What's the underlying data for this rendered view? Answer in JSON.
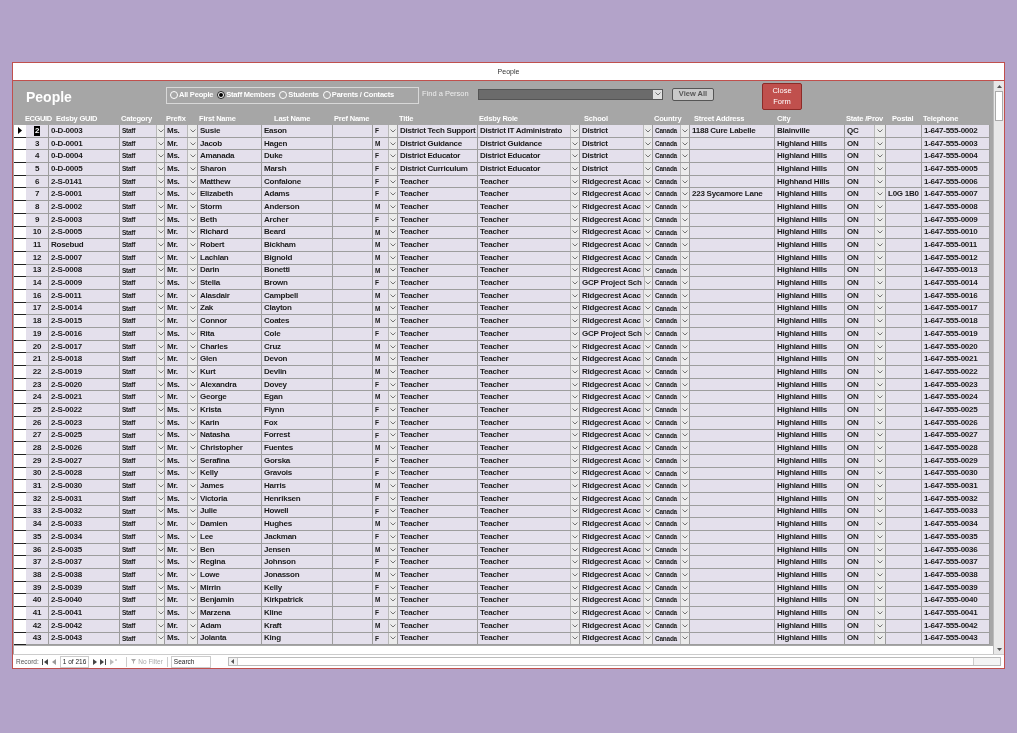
{
  "window": {
    "title": "People"
  },
  "form": {
    "title": "People",
    "filter_options": [
      {
        "label": "All People",
        "selected": false
      },
      {
        "label": "Staff Members",
        "selected": true
      },
      {
        "label": "Students",
        "selected": false
      },
      {
        "label": "Parents / Contacts",
        "selected": false
      }
    ],
    "find_label": "Find a Person",
    "view_all": "View All",
    "close": "Close Form"
  },
  "table": {
    "columns": [
      "ECGUID",
      "Edsby GUID",
      "Category",
      "Prefix",
      "First Name",
      "Last Name",
      "Pref Name",
      "Title",
      "Edsby Role",
      "School",
      "Country",
      "Street Address",
      "City",
      "State /Prov",
      "Postal",
      "Telephone"
    ],
    "rows": [
      {
        "selected": true,
        "ecguid": "2",
        "guid": "0-D-0003",
        "category": "Staff",
        "prefix": "Ms.",
        "first": "Susie",
        "last": "Eason",
        "gender": "F",
        "title": "District Tech Support",
        "role": "District IT Administrato",
        "school": "District",
        "country": "Canada",
        "street": "1188 Cure Labelle",
        "city": "Blainville",
        "prov": "QC",
        "phone": "1-647-555-0002"
      },
      {
        "selected": false,
        "ecguid": "3",
        "guid": "0-D-0001",
        "category": "Staff",
        "prefix": "Mr.",
        "first": "Jacob",
        "last": "Hagen",
        "gender": "M",
        "title": "District Guidance",
        "role": "District Guidance",
        "school": "District",
        "country": "Canada",
        "city": "Highland Hills",
        "prov": "ON",
        "phone": "1-647-555-0003"
      },
      {
        "selected": false,
        "ecguid": "4",
        "guid": "0-D-0004",
        "category": "Staff",
        "prefix": "Ms.",
        "first": "Amanada",
        "last": "Duke",
        "gender": "F",
        "title": "District Educator",
        "role": "District Educator",
        "school": "District",
        "country": "Canada",
        "city": "Highland Hills",
        "prov": "ON",
        "phone": "1-647-555-0004"
      },
      {
        "selected": false,
        "ecguid": "5",
        "guid": "0-D-0005",
        "category": "Staff",
        "prefix": "Ms.",
        "first": "Sharon",
        "last": "Marsh",
        "gender": "F",
        "title": "District Curriculum",
        "role": "District Educator",
        "school": "District",
        "country": "Canada",
        "city": "Highland Hills",
        "prov": "ON",
        "phone": "1-647-555-0005"
      },
      {
        "selected": false,
        "ecguid": "6",
        "guid": "2-S-0141",
        "category": "Staff",
        "prefix": "Ms.",
        "first": "Matthew",
        "last": "Confalone",
        "gender": "F",
        "title": "Teacher",
        "role": "Teacher",
        "school": "Ridgecrest Acac",
        "country": "Canada",
        "city": "Highhand Hills",
        "prov": "ON",
        "phone": "1-647-555-0006"
      },
      {
        "selected": false,
        "ecguid": "7",
        "guid": "2-S-0001",
        "category": "Staff",
        "prefix": "Ms.",
        "first": "Elizabeth",
        "last": "Adams",
        "gender": "F",
        "title": "Teacher",
        "role": "Teacher",
        "school": "Ridgecrest Acac",
        "country": "Canada",
        "street": "223 Sycamore Lane",
        "city": "Highland Hills",
        "prov": "ON",
        "postal": "L0G 1B0",
        "phone": "1-647-555-0007"
      },
      {
        "selected": false,
        "ecguid": "8",
        "guid": "2-S-0002",
        "category": "Staff",
        "prefix": "Mr.",
        "first": "Storm",
        "last": "Anderson",
        "gender": "M",
        "title": "Teacher",
        "role": "Teacher",
        "school": "Ridgecrest Acac",
        "country": "Canada",
        "city": "Highland Hills",
        "prov": "ON",
        "phone": "1-647-555-0008"
      },
      {
        "selected": false,
        "ecguid": "9",
        "guid": "2-S-0003",
        "category": "Staff",
        "prefix": "Ms.",
        "first": "Beth",
        "last": "Archer",
        "gender": "F",
        "title": "Teacher",
        "role": "Teacher",
        "school": "Ridgecrest Acac",
        "country": "Canada",
        "city": "Highland Hills",
        "prov": "ON",
        "phone": "1-647-555-0009"
      },
      {
        "selected": false,
        "ecguid": "10",
        "guid": "2-S-0005",
        "category": "Staff",
        "prefix": "Mr.",
        "first": "Richard",
        "last": "Beard",
        "gender": "M",
        "title": "Teacher",
        "role": "Teacher",
        "school": "Ridgecrest Acac",
        "country": "Canada",
        "city": "Highland Hills",
        "prov": "ON",
        "phone": "1-647-555-0010"
      },
      {
        "selected": false,
        "ecguid": "11",
        "guid": "Rosebud",
        "category": "Staff",
        "prefix": "Mr.",
        "first": "Robert",
        "last": "Bickham",
        "gender": "M",
        "title": "Teacher",
        "role": "Teacher",
        "school": "Ridgecrest Acac",
        "country": "Canada",
        "city": "Highland Hills",
        "prov": "ON",
        "phone": "1-647-555-0011"
      },
      {
        "selected": false,
        "ecguid": "12",
        "guid": "2-S-0007",
        "category": "Staff",
        "prefix": "Mr.",
        "first": "Lachlan",
        "last": "Bignold",
        "gender": "M",
        "title": "Teacher",
        "role": "Teacher",
        "school": "Ridgecrest Acac",
        "country": "Canada",
        "city": "Highland Hills",
        "prov": "ON",
        "phone": "1-647-555-0012"
      },
      {
        "selected": false,
        "ecguid": "13",
        "guid": "2-S-0008",
        "category": "Staff",
        "prefix": "Mr.",
        "first": "Darin",
        "last": "Bonetti",
        "gender": "M",
        "title": "Teacher",
        "role": "Teacher",
        "school": "Ridgecrest Acac",
        "country": "Canada",
        "city": "Highland Hills",
        "prov": "ON",
        "phone": "1-647-555-0013"
      },
      {
        "selected": false,
        "ecguid": "14",
        "guid": "2-S-0009",
        "category": "Staff",
        "prefix": "Ms.",
        "first": "Stella",
        "last": "Brown",
        "gender": "F",
        "title": "Teacher",
        "role": "Teacher",
        "school": "GCP Project Sch",
        "country": "Canada",
        "city": "Highland Hills",
        "prov": "ON",
        "phone": "1-647-555-0014"
      },
      {
        "selected": false,
        "ecguid": "16",
        "guid": "2-S-0011",
        "category": "Staff",
        "prefix": "Mr.",
        "first": "Alasdair",
        "last": "Campbell",
        "gender": "M",
        "title": "Teacher",
        "role": "Teacher",
        "school": "Ridgecrest Acac",
        "country": "Canada",
        "city": "Highland Hills",
        "prov": "ON",
        "phone": "1-647-555-0016"
      },
      {
        "selected": false,
        "ecguid": "17",
        "guid": "2-S-0014",
        "category": "Staff",
        "prefix": "Mr.",
        "first": "Zak",
        "last": "Clayton",
        "gender": "M",
        "title": "Teacher",
        "role": "Teacher",
        "school": "Ridgecrest Acac",
        "country": "Canada",
        "city": "Highland Hills",
        "prov": "ON",
        "phone": "1-647-555-0017"
      },
      {
        "selected": false,
        "ecguid": "18",
        "guid": "2-S-0015",
        "category": "Staff",
        "prefix": "Mr.",
        "first": "Connor",
        "last": "Coates",
        "gender": "M",
        "title": "Teacher",
        "role": "Teacher",
        "school": "Ridgecrest Acac",
        "country": "Canada",
        "city": "Highland Hills",
        "prov": "ON",
        "phone": "1-647-555-0018"
      },
      {
        "selected": false,
        "ecguid": "19",
        "guid": "2-S-0016",
        "category": "Staff",
        "prefix": "Ms.",
        "first": "Rita",
        "last": "Cole",
        "gender": "F",
        "title": "Teacher",
        "role": "Teacher",
        "school": "GCP Project Sch",
        "country": "Canada",
        "city": "Highland Hills",
        "prov": "ON",
        "phone": "1-647-555-0019"
      },
      {
        "selected": false,
        "ecguid": "20",
        "guid": "2-S-0017",
        "category": "Staff",
        "prefix": "Mr.",
        "first": "Charles",
        "last": "Cruz",
        "gender": "M",
        "title": "Teacher",
        "role": "Teacher",
        "school": "Ridgecrest Acac",
        "country": "Canada",
        "city": "Highland Hills",
        "prov": "ON",
        "phone": "1-647-555-0020"
      },
      {
        "selected": false,
        "ecguid": "21",
        "guid": "2-S-0018",
        "category": "Staff",
        "prefix": "Mr.",
        "first": "Glen",
        "last": "Devon",
        "gender": "M",
        "title": "Teacher",
        "role": "Teacher",
        "school": "Ridgecrest Acac",
        "country": "Canada",
        "city": "Highland Hills",
        "prov": "ON",
        "phone": "1-647-555-0021"
      },
      {
        "selected": false,
        "ecguid": "22",
        "guid": "2-S-0019",
        "category": "Staff",
        "prefix": "Mr.",
        "first": "Kurt",
        "last": "Devlin",
        "gender": "M",
        "title": "Teacher",
        "role": "Teacher",
        "school": "Ridgecrest Acac",
        "country": "Canada",
        "city": "Highland Hills",
        "prov": "ON",
        "phone": "1-647-555-0022"
      },
      {
        "selected": false,
        "ecguid": "23",
        "guid": "2-S-0020",
        "category": "Staff",
        "prefix": "Ms.",
        "first": "Alexandra",
        "last": "Dovey",
        "gender": "F",
        "title": "Teacher",
        "role": "Teacher",
        "school": "Ridgecrest Acac",
        "country": "Canada",
        "city": "Highland Hills",
        "prov": "ON",
        "phone": "1-647-555-0023"
      },
      {
        "selected": false,
        "ecguid": "24",
        "guid": "2-S-0021",
        "category": "Staff",
        "prefix": "Mr.",
        "first": "George",
        "last": "Egan",
        "gender": "M",
        "title": "Teacher",
        "role": "Teacher",
        "school": "Ridgecrest Acac",
        "country": "Canada",
        "city": "Highland Hills",
        "prov": "ON",
        "phone": "1-647-555-0024"
      },
      {
        "selected": false,
        "ecguid": "25",
        "guid": "2-S-0022",
        "category": "Staff",
        "prefix": "Ms.",
        "first": "Krista",
        "last": "Flynn",
        "gender": "F",
        "title": "Teacher",
        "role": "Teacher",
        "school": "Ridgecrest Acac",
        "country": "Canada",
        "city": "Highland Hills",
        "prov": "ON",
        "phone": "1-647-555-0025"
      },
      {
        "selected": false,
        "ecguid": "26",
        "guid": "2-S-0023",
        "category": "Staff",
        "prefix": "Ms.",
        "first": "Karin",
        "last": "Fox",
        "gender": "F",
        "title": "Teacher",
        "role": "Teacher",
        "school": "Ridgecrest Acac",
        "country": "Canada",
        "city": "Highland Hills",
        "prov": "ON",
        "phone": "1-647-555-0026"
      },
      {
        "selected": false,
        "ecguid": "27",
        "guid": "2-S-0025",
        "category": "Staff",
        "prefix": "Ms.",
        "first": "Natasha",
        "last": "Forrest",
        "gender": "F",
        "title": "Teacher",
        "role": "Teacher",
        "school": "Ridgecrest Acac",
        "country": "Canada",
        "city": "Highland Hills",
        "prov": "ON",
        "phone": "1-647-555-0027"
      },
      {
        "selected": false,
        "ecguid": "28",
        "guid": "2-S-0026",
        "category": "Staff",
        "prefix": "Mr.",
        "first": "Christopher",
        "last": "Fuentes",
        "gender": "M",
        "title": "Teacher",
        "role": "Teacher",
        "school": "Ridgecrest Acac",
        "country": "Canada",
        "city": "Highland Hills",
        "prov": "ON",
        "phone": "1-647-555-0028"
      },
      {
        "selected": false,
        "ecguid": "29",
        "guid": "2-S-0027",
        "category": "Staff",
        "prefix": "Ms.",
        "first": "Serafina",
        "last": "Gorska",
        "gender": "F",
        "title": "Teacher",
        "role": "Teacher",
        "school": "Ridgecrest Acac",
        "country": "Canada",
        "city": "Highland Hills",
        "prov": "ON",
        "phone": "1-647-555-0029"
      },
      {
        "selected": false,
        "ecguid": "30",
        "guid": "2-S-0028",
        "category": "Staff",
        "prefix": "Ms.",
        "first": "Kelly",
        "last": "Gravois",
        "gender": "F",
        "title": "Teacher",
        "role": "Teacher",
        "school": "Ridgecrest Acac",
        "country": "Canada",
        "city": "Highland Hills",
        "prov": "ON",
        "phone": "1-647-555-0030"
      },
      {
        "selected": false,
        "ecguid": "31",
        "guid": "2-S-0030",
        "category": "Staff",
        "prefix": "Mr.",
        "first": "James",
        "last": "Harris",
        "gender": "M",
        "title": "Teacher",
        "role": "Teacher",
        "school": "Ridgecrest Acac",
        "country": "Canada",
        "city": "Highland Hills",
        "prov": "ON",
        "phone": "1-647-555-0031"
      },
      {
        "selected": false,
        "ecguid": "32",
        "guid": "2-S-0031",
        "category": "Staff",
        "prefix": "Ms.",
        "first": "Victoria",
        "last": "Henriksen",
        "gender": "F",
        "title": "Teacher",
        "role": "Teacher",
        "school": "Ridgecrest Acac",
        "country": "Canada",
        "city": "Highland Hills",
        "prov": "ON",
        "phone": "1-647-555-0032"
      },
      {
        "selected": false,
        "ecguid": "33",
        "guid": "2-S-0032",
        "category": "Staff",
        "prefix": "Ms.",
        "first": "Julie",
        "last": "Howell",
        "gender": "F",
        "title": "Teacher",
        "role": "Teacher",
        "school": "Ridgecrest Acac",
        "country": "Canada",
        "city": "Highland Hills",
        "prov": "ON",
        "phone": "1-647-555-0033"
      },
      {
        "selected": false,
        "ecguid": "34",
        "guid": "2-S-0033",
        "category": "Staff",
        "prefix": "Mr.",
        "first": "Damien",
        "last": "Hughes",
        "gender": "M",
        "title": "Teacher",
        "role": "Teacher",
        "school": "Ridgecrest Acac",
        "country": "Canada",
        "city": "Highland Hills",
        "prov": "ON",
        "phone": "1-647-555-0034"
      },
      {
        "selected": false,
        "ecguid": "35",
        "guid": "2-S-0034",
        "category": "Staff",
        "prefix": "Ms.",
        "first": "Lee",
        "last": "Jackman",
        "gender": "F",
        "title": "Teacher",
        "role": "Teacher",
        "school": "Ridgecrest Acac",
        "country": "Canada",
        "city": "Highland Hills",
        "prov": "ON",
        "phone": "1-647-555-0035"
      },
      {
        "selected": false,
        "ecguid": "36",
        "guid": "2-S-0035",
        "category": "Staff",
        "prefix": "Mr.",
        "first": "Ben",
        "last": "Jensen",
        "gender": "M",
        "title": "Teacher",
        "role": "Teacher",
        "school": "Ridgecrest Acac",
        "country": "Canada",
        "city": "Highland Hills",
        "prov": "ON",
        "phone": "1-647-555-0036"
      },
      {
        "selected": false,
        "ecguid": "37",
        "guid": "2-S-0037",
        "category": "Staff",
        "prefix": "Ms.",
        "first": "Regina",
        "last": "Johnson",
        "gender": "F",
        "title": "Teacher",
        "role": "Teacher",
        "school": "Ridgecrest Acac",
        "country": "Canada",
        "city": "Highland Hills",
        "prov": "ON",
        "phone": "1-647-555-0037"
      },
      {
        "selected": false,
        "ecguid": "38",
        "guid": "2-S-0038",
        "category": "Staff",
        "prefix": "Mr.",
        "first": "Lowe",
        "last": "Jonasson",
        "gender": "M",
        "title": "Teacher",
        "role": "Teacher",
        "school": "Ridgecrest Acac",
        "country": "Canada",
        "city": "Highland Hills",
        "prov": "ON",
        "phone": "1-647-555-0038"
      },
      {
        "selected": false,
        "ecguid": "39",
        "guid": "2-S-0039",
        "category": "Staff",
        "prefix": "Ms.",
        "first": "Mirrin",
        "last": "Kelly",
        "gender": "F",
        "title": "Teacher",
        "role": "Teacher",
        "school": "Ridgecrest Acac",
        "country": "Canada",
        "city": "Highland Hills",
        "prov": "ON",
        "phone": "1-647-555-0039"
      },
      {
        "selected": false,
        "ecguid": "40",
        "guid": "2-S-0040",
        "category": "Staff",
        "prefix": "Mr.",
        "first": "Benjamin",
        "last": "Kirkpatrick",
        "gender": "M",
        "title": "Teacher",
        "role": "Teacher",
        "school": "Ridgecrest Acac",
        "country": "Canada",
        "city": "Highland Hills",
        "prov": "ON",
        "phone": "1-647-555-0040"
      },
      {
        "selected": false,
        "ecguid": "41",
        "guid": "2-S-0041",
        "category": "Staff",
        "prefix": "Ms.",
        "first": "Marzena",
        "last": "Kline",
        "gender": "F",
        "title": "Teacher",
        "role": "Teacher",
        "school": "Ridgecrest Acac",
        "country": "Canada",
        "city": "Highland Hills",
        "prov": "ON",
        "phone": "1-647-555-0041"
      },
      {
        "selected": false,
        "ecguid": "42",
        "guid": "2-S-0042",
        "category": "Staff",
        "prefix": "Mr.",
        "first": "Adam",
        "last": "Kraft",
        "gender": "M",
        "title": "Teacher",
        "role": "Teacher",
        "school": "Ridgecrest Acac",
        "country": "Canada",
        "city": "Highland Hills",
        "prov": "ON",
        "phone": "1-647-555-0042"
      },
      {
        "selected": false,
        "ecguid": "43",
        "guid": "2-S-0043",
        "category": "Staff",
        "prefix": "Ms.",
        "first": "Jolanta",
        "last": "King",
        "gender": "F",
        "title": "Teacher",
        "role": "Teacher",
        "school": "Ridgecrest Acac",
        "country": "Canada",
        "city": "Highland Hills",
        "prov": "ON",
        "phone": "1-647-555-0043"
      }
    ]
  },
  "navigator": {
    "label": "Record:",
    "position": "1 of 216",
    "filter": "No Filter",
    "search": "Search"
  }
}
